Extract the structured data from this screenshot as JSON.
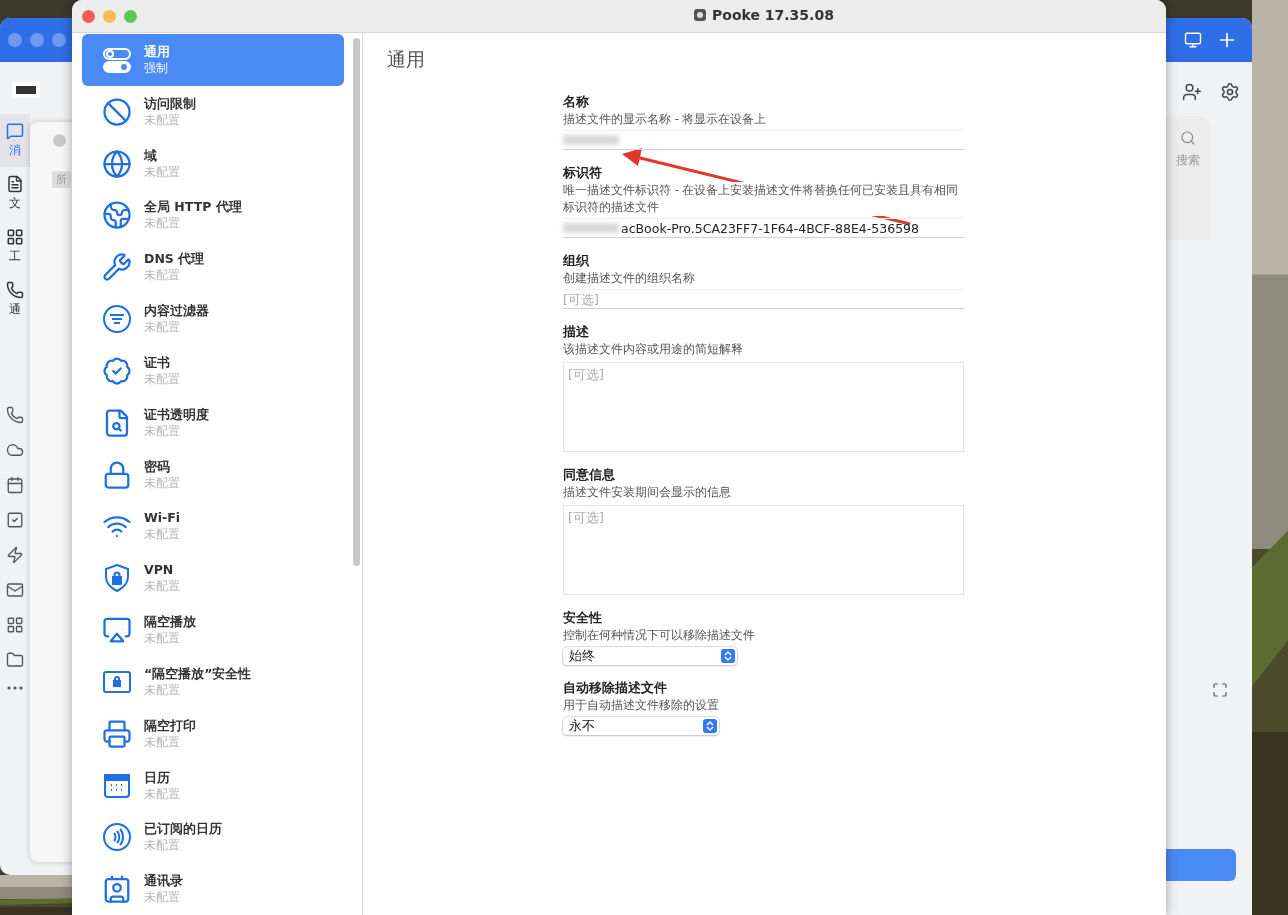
{
  "background_left": {
    "nav_labels": [
      {
        "label": "消",
        "selected": true
      },
      {
        "label": "文",
        "selected": false
      },
      {
        "label": "工",
        "selected": false
      },
      {
        "label": "通",
        "selected": false
      }
    ],
    "chip": "所"
  },
  "window": {
    "title": "Pooke 17.35.08"
  },
  "sidebar": {
    "items": [
      {
        "kind": "toggles",
        "title": "通用",
        "subtitle": "强制",
        "selected": true
      },
      {
        "kind": "ban",
        "title": "访问限制",
        "subtitle": "未配置",
        "selected": false
      },
      {
        "kind": "globe",
        "title": "域",
        "subtitle": "未配置",
        "selected": false
      },
      {
        "kind": "network",
        "title": "全局 HTTP 代理",
        "subtitle": "未配置",
        "selected": false
      },
      {
        "kind": "tools",
        "title": "DNS 代理",
        "subtitle": "未配置",
        "selected": false
      },
      {
        "kind": "filter",
        "title": "内容过滤器",
        "subtitle": "未配置",
        "selected": false
      },
      {
        "kind": "badge",
        "title": "证书",
        "subtitle": "未配置",
        "selected": false
      },
      {
        "kind": "docsearch",
        "title": "证书透明度",
        "subtitle": "未配置",
        "selected": false
      },
      {
        "kind": "lock",
        "title": "密码",
        "subtitle": "未配置",
        "selected": false
      },
      {
        "kind": "wifi",
        "title": "Wi-Fi",
        "subtitle": "未配置",
        "selected": false
      },
      {
        "kind": "shield",
        "title": "VPN",
        "subtitle": "未配置",
        "selected": false
      },
      {
        "kind": "airplay",
        "title": "隔空播放",
        "subtitle": "未配置",
        "selected": false
      },
      {
        "kind": "screenlock",
        "title": "“隔空播放”安全性",
        "subtitle": "未配置",
        "selected": false
      },
      {
        "kind": "printer",
        "title": "隔空打印",
        "subtitle": "未配置",
        "selected": false
      },
      {
        "kind": "calendar",
        "title": "日历",
        "subtitle": "未配置",
        "selected": false
      },
      {
        "kind": "waves",
        "title": "已订阅的日历",
        "subtitle": "未配置",
        "selected": false
      },
      {
        "kind": "contact",
        "title": "通讯录",
        "subtitle": "未配置",
        "selected": false
      }
    ]
  },
  "content": {
    "heading": "通用",
    "fields": [
      {
        "kind": "text",
        "label": "名称",
        "description": "描述文件的显示名称 - 将显示在设备上",
        "redacted": true
      },
      {
        "kind": "text",
        "label": "标识符",
        "description": "唯一描述文件标识符 - 在设备上安装描述文件将替换任何已安装且具有相同标识符的描述文件",
        "value": "acBook-Pro.5CA23FF7-1F64-4BCF-88E4-536598",
        "redacted": true
      },
      {
        "kind": "text",
        "label": "组织",
        "description": "创建描述文件的组织名称",
        "placeholder": "[可选]"
      },
      {
        "kind": "textarea",
        "label": "描述",
        "description": "该描述文件内容或用途的简短解释",
        "placeholder": "[可选]"
      },
      {
        "kind": "textarea",
        "label": "同意信息",
        "description": "描述文件安装期间会显示的信息",
        "placeholder": "[可选]"
      },
      {
        "kind": "select",
        "label": "安全性",
        "description": "控制在何种情况下可以移除描述文件",
        "value": "始终"
      },
      {
        "kind": "select",
        "label": "自动移除描述文件",
        "description": "用于自动描述文件移除的设置",
        "value": "永不"
      }
    ]
  },
  "background_right": {
    "search_label": "搜索"
  }
}
